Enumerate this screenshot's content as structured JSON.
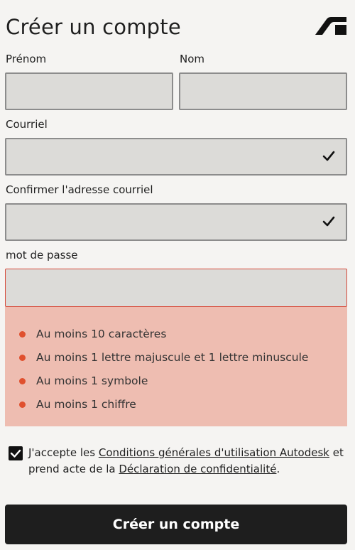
{
  "header": {
    "title": "Créer un compte",
    "logo_icon": "autodesk-logo-icon"
  },
  "form": {
    "first_name_label": "Prénom",
    "last_name_label": "Nom",
    "email_label": "Courriel",
    "confirm_email_label": "Confirmer l'adresse courriel",
    "password_label": "mot de passe",
    "first_name_value": "",
    "last_name_value": "",
    "email_value": "",
    "confirm_email_value": "",
    "password_value": ""
  },
  "password_requirements": [
    "Au moins 10 caractères",
    "Au moins 1 lettre majuscule et 1 lettre minuscule",
    "Au moins 1 symbole",
    "Au moins 1 chiffre"
  ],
  "accept": {
    "text_1": "J'accepte les ",
    "terms_link": "Conditions générales d'utilisation Autodesk",
    "text_2": " et prend acte de la ",
    "privacy_link": "Déclaration de confidentialité",
    "text_3": ".",
    "checked": true
  },
  "submit_label": "Créer un compte",
  "colors": {
    "error_bg": "#eebdb1",
    "error_dot": "#e0502e",
    "button_bg": "#1e1e1e"
  }
}
